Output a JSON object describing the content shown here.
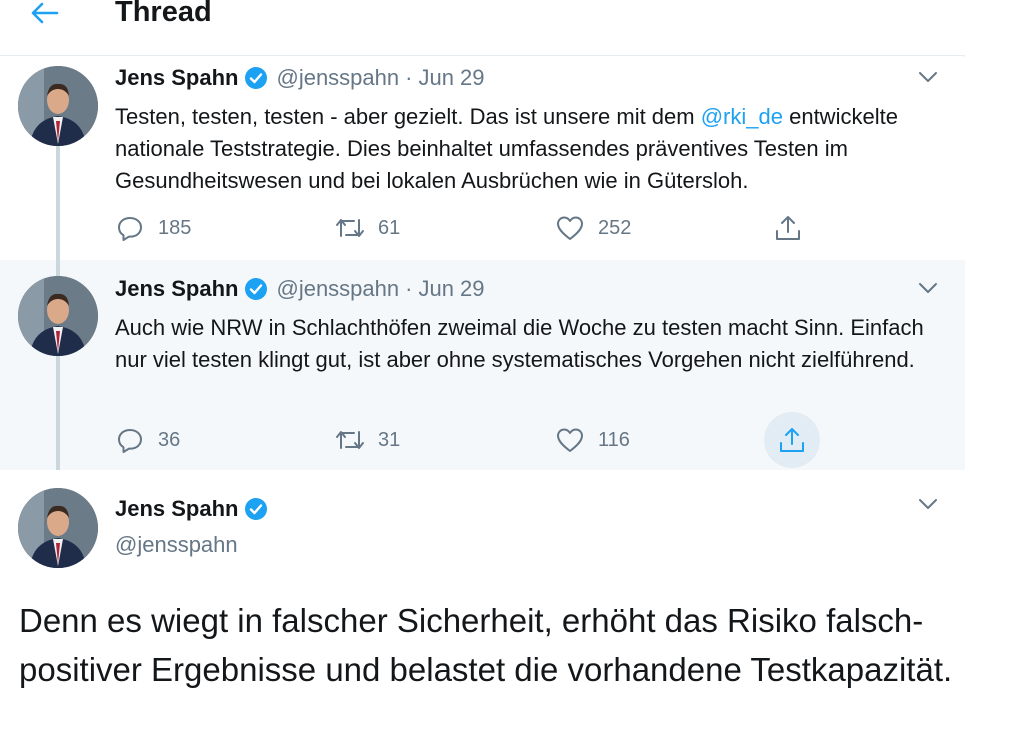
{
  "header": {
    "title": "Thread"
  },
  "tweets": [
    {
      "name": "Jens Spahn",
      "handle": "@jensspahn",
      "separator": "·",
      "date": "Jun 29",
      "text_parts": [
        "Testen, testen, testen - aber gezielt. Das ist unsere mit dem ",
        "@rki_de",
        " entwickelte nationale Teststrategie. Dies beinhaltet umfassendes präventives Testen im Gesundheitswesen und bei lokalen Ausbrüchen wie in Gütersloh."
      ],
      "replies": "185",
      "retweets": "61",
      "likes": "252"
    },
    {
      "name": "Jens Spahn",
      "handle": "@jensspahn",
      "separator": "·",
      "date": "Jun 29",
      "text": "Auch wie NRW in Schlachthöfen zweimal die Woche zu testen macht Sinn. Einfach nur viel testen klingt gut, ist aber ohne systematisches Vorgehen nicht zielführend.",
      "replies": "36",
      "retweets": "31",
      "likes": "116"
    },
    {
      "name": "Jens Spahn",
      "handle": "@jensspahn",
      "text": "Denn es wiegt in falscher Sicherheit, erhöht das Risiko falsch-positiver Ergebnisse und belastet die vorhandene Testkapazität."
    }
  ],
  "colors": {
    "accent": "#1da1f2",
    "text": "#14171a",
    "secondary": "#657786",
    "border": "#e6ecf0",
    "highlight_bg": "#f5f8fa"
  },
  "icons": [
    "back-arrow-icon",
    "verified-badge-icon",
    "chevron-down-icon",
    "reply-icon",
    "retweet-icon",
    "like-icon",
    "share-icon"
  ]
}
